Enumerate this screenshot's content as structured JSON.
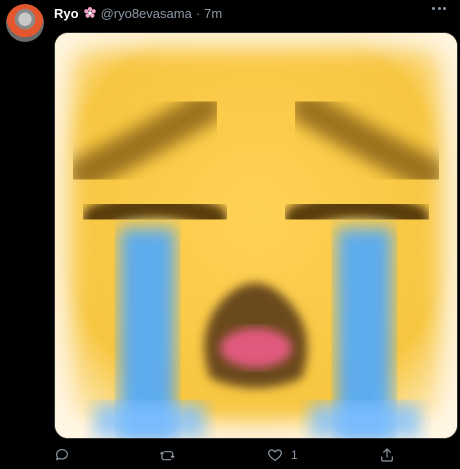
{
  "tweet": {
    "author_name": "Ryo",
    "author_handle": "@ryo8evasama",
    "separator": "·",
    "timestamp": "7m",
    "media_alt": "Loudly crying face emoji",
    "actions": {
      "reply_count": "",
      "retweet_count": "",
      "like_count": "1",
      "share_count": ""
    }
  },
  "icons": {
    "avatar": "avatar",
    "badge": "flower-icon",
    "more": "more-icon",
    "reply": "reply-icon",
    "retweet": "retweet-icon",
    "like": "heart-icon",
    "share": "share-icon"
  },
  "colors": {
    "background": "#000000",
    "text": "#ffffff",
    "muted": "#8b98a5",
    "emoji_yellow": "#f4c43c",
    "tears": "#4da8ff",
    "mouth": "#6b4a1a",
    "tongue": "#e05a7d"
  }
}
